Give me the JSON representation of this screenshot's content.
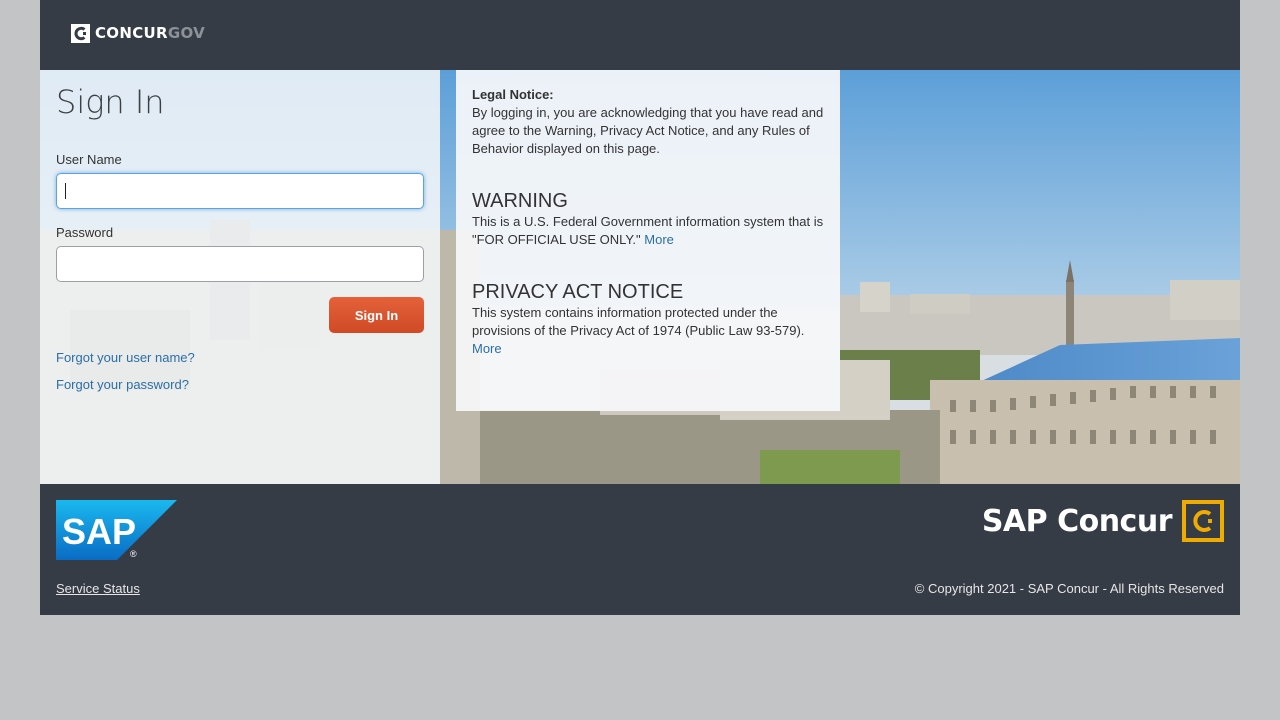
{
  "header": {
    "logo_primary": "CONCUR",
    "logo_secondary": "GOV"
  },
  "signin": {
    "title": "Sign In",
    "username_label": "User Name",
    "username_value": "",
    "password_label": "Password",
    "password_value": "",
    "submit_label": "Sign In",
    "forgot_username": "Forgot your user name?",
    "forgot_password": "Forgot your password?"
  },
  "notice": {
    "legal_title": "Legal Notice:",
    "legal_text": "By logging in, you are acknowledging that you have read and agree to the Warning, Privacy Act Notice, and any Rules of Behavior displayed on this page.",
    "warning_title": "WARNING",
    "warning_text": "This is a U.S. Federal Government information system that is \"FOR OFFICIAL USE ONLY.\"",
    "warning_more": "More",
    "privacy_title": "PRIVACY ACT NOTICE",
    "privacy_text": "This system contains information protected under the provisions of the Privacy Act of 1974 (Public Law 93-579).",
    "privacy_more": "More"
  },
  "footer": {
    "sap_logo_text": "SAP",
    "concur_logo_text": "SAP Concur",
    "service_status": "Service Status",
    "copyright": "© Copyright 2021 - SAP Concur - All Rights Reserved"
  },
  "colors": {
    "header_bg": "#363c45",
    "button": "#d9532c",
    "link": "#2a6fa8",
    "concur_yellow": "#f0ab00",
    "sap_blue": "#0a84d6"
  }
}
